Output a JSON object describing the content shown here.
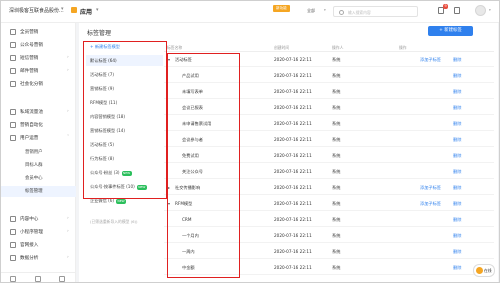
{
  "topbar": {
    "store_name": "深圳极客互联食品股份...",
    "app_name": "应用",
    "promo": "新功能",
    "scope": "全部",
    "search_placeholder": "输入搜索内容",
    "notification_count": "9"
  },
  "sidebar": {
    "items": [
      {
        "label": "全员营销"
      },
      {
        "label": "公众号营销"
      },
      {
        "label": "短信营销"
      },
      {
        "label": "邮件营销"
      },
      {
        "label": "社会化分销"
      },
      {
        "label": "私域流量池"
      },
      {
        "label": "营销自动化"
      },
      {
        "label": "用户运营"
      }
    ],
    "sub_items": [
      {
        "label": "营销用户"
      },
      {
        "label": "目标人群"
      },
      {
        "label": "会员中心"
      },
      {
        "label": "标签管理"
      }
    ],
    "items_after": [
      {
        "label": "内容中心"
      },
      {
        "label": "小程序管理"
      },
      {
        "label": "官网接入"
      },
      {
        "label": "数据分析"
      }
    ]
  },
  "main": {
    "title": "标签管理",
    "new_tag_button": "+ 新建标签",
    "columns": {
      "name": "标签名称",
      "time": "创建时间",
      "operator": "操作人",
      "action": "操作"
    },
    "groups": {
      "add_label": "+ 新建标签模型",
      "items": [
        {
          "label": "默认标签 (64)",
          "new": false
        },
        {
          "label": "活动标签 (7)",
          "new": false
        },
        {
          "label": "营销标签 (9)",
          "new": false
        },
        {
          "label": "RFM模型 (11)",
          "new": false
        },
        {
          "label": "内容营销模型 (18)",
          "new": false
        },
        {
          "label": "营销标签模型 (14)",
          "new": false
        },
        {
          "label": "活动标签 (5)",
          "new": false
        },
        {
          "label": "行为标签 (8)",
          "new": false
        },
        {
          "label": "公众号·粉丝 (3)",
          "new": true,
          "new_label": "NEW"
        },
        {
          "label": "公众号·按事件标签 (10)",
          "new": true,
          "new_label": "NEW"
        },
        {
          "label": "企业微信 (6)",
          "new": true,
          "new_label": "NEW"
        }
      ],
      "note": "(已筛选重新导入的模型 (6))"
    },
    "rows": [
      {
        "name": "活动标签",
        "time": "2020-07-16 22:11",
        "operator": "系统",
        "add_child": "添加子标签",
        "delete": "删除",
        "level": 0,
        "expanded": true
      },
      {
        "name": "产品试用",
        "time": "2020-07-16 22:11",
        "operator": "系统",
        "add_child": "",
        "delete": "删除",
        "level": 1
      },
      {
        "name": "未填写表单",
        "time": "2020-07-16 22:11",
        "operator": "系统",
        "add_child": "",
        "delete": "删除",
        "level": 1
      },
      {
        "name": "会议已报表",
        "time": "2020-07-16 22:11",
        "operator": "系统",
        "add_child": "",
        "delete": "删除",
        "level": 1
      },
      {
        "name": "未申请售票试用",
        "time": "2020-07-16 22:11",
        "operator": "系统",
        "add_child": "",
        "delete": "删除",
        "level": 1
      },
      {
        "name": "会议参与者",
        "time": "2020-07-16 22:11",
        "operator": "系统",
        "add_child": "",
        "delete": "删除",
        "level": 1
      },
      {
        "name": "免费试用",
        "time": "2020-07-16 22:11",
        "operator": "系统",
        "add_child": "",
        "delete": "删除",
        "level": 1
      },
      {
        "name": "关注公众号",
        "time": "2020-07-16 22:11",
        "operator": "系统",
        "add_child": "",
        "delete": "删除",
        "level": 1
      },
      {
        "name": "社交传播影响",
        "time": "2020-07-16 22:11",
        "operator": "系统",
        "add_child": "添加子标签",
        "delete": "删除",
        "level": 0,
        "expanded": false
      },
      {
        "name": "RFM模型",
        "time": "2020-07-16 22:11",
        "operator": "系统",
        "add_child": "添加子标签",
        "delete": "删除",
        "level": 0,
        "expanded": true
      },
      {
        "name": "CRM",
        "time": "2020-07-16 22:11",
        "operator": "系统",
        "add_child": "",
        "delete": "删除",
        "level": 1
      },
      {
        "name": "一个月内",
        "time": "2020-07-16 22:11",
        "operator": "系统",
        "add_child": "",
        "delete": "删除",
        "level": 1
      },
      {
        "name": "一周内",
        "time": "2020-07-16 22:11",
        "operator": "系统",
        "add_child": "",
        "delete": "删除",
        "level": 1
      },
      {
        "name": "中金额",
        "time": "2020-07-16 22:11",
        "operator": "系统",
        "add_child": "",
        "delete": "删除",
        "level": 1
      }
    ]
  },
  "service": {
    "label": "在线"
  }
}
